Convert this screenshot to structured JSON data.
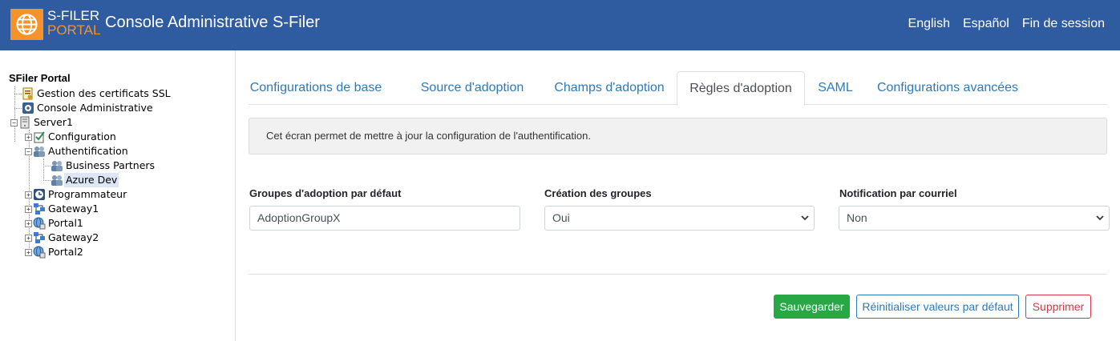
{
  "header": {
    "logo_line1": "S-FILER",
    "logo_line2": "PORTAL",
    "title": "Console Administrative S-Filer",
    "links": [
      "English",
      "Español",
      "Fin de session"
    ]
  },
  "tree": {
    "root": "SFiler Portal",
    "items": [
      {
        "label": "Gestion des certificats SSL",
        "icon": "certificate-icon"
      },
      {
        "label": "Console Administrative",
        "icon": "admin-console-icon"
      },
      {
        "label": "Server1",
        "icon": "server-icon",
        "expander": "−"
      },
      {
        "label": "Configuration",
        "icon": "checklist-icon",
        "expander": "+"
      },
      {
        "label": "Authentification",
        "icon": "users-icon",
        "expander": "−"
      },
      {
        "label": "Business Partners",
        "icon": "users-icon"
      },
      {
        "label": "Azure Dev",
        "icon": "users-icon",
        "selected": true
      },
      {
        "label": "Programmateur",
        "icon": "clock-icon",
        "expander": "+"
      },
      {
        "label": "Gateway1",
        "icon": "gateway-icon",
        "expander": "+"
      },
      {
        "label": "Portal1",
        "icon": "portal-icon",
        "expander": "+"
      },
      {
        "label": "Gateway2",
        "icon": "gateway-icon",
        "expander": "+"
      },
      {
        "label": "Portal2",
        "icon": "portal-icon",
        "expander": "+"
      }
    ]
  },
  "tabs": [
    {
      "label": "Configurations de base"
    },
    {
      "label": "Source d'adoption"
    },
    {
      "label": "Champs d'adoption"
    },
    {
      "label": "Règles d'adoption",
      "active": true
    },
    {
      "label": "SAML"
    },
    {
      "label": "Configurations avancées"
    }
  ],
  "info_text": "Cet écran permet de mettre à jour la configuration de l'authentification.",
  "form": {
    "group_label": "Groupes d'adoption par défaut",
    "group_value": "AdoptionGroupX",
    "create_label": "Création des groupes",
    "create_value": "Oui",
    "notify_label": "Notification par courriel",
    "notify_value": "Non"
  },
  "buttons": {
    "save": "Sauvegarder",
    "reset": "Réinitialiser valeurs par défaut",
    "delete": "Supprimer"
  },
  "colors": {
    "header_bg": "#2f5ba0",
    "logo_orange": "#f5922a",
    "link_blue": "#2a7ac0",
    "success": "#28a745",
    "danger": "#dc3545"
  }
}
